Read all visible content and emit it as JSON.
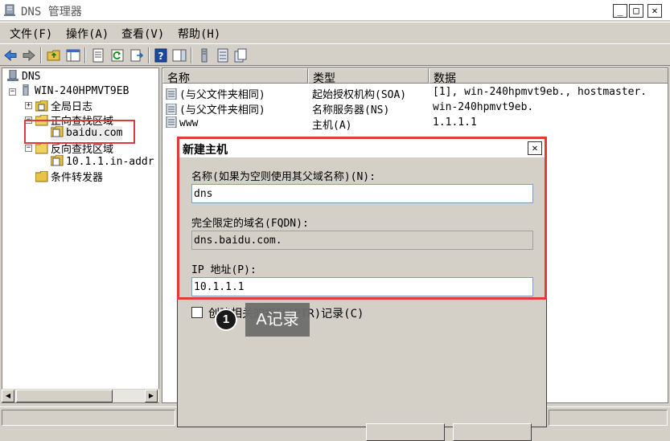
{
  "window": {
    "title": "DNS 管理器",
    "minimize": "_",
    "maximize": "□",
    "close": "✕"
  },
  "menu": [
    "文件(F)",
    "操作(A)",
    "查看(V)",
    "帮助(H)"
  ],
  "tree": {
    "root": "DNS",
    "server": "WIN-240HPMVT9EB",
    "global_logs": "全局日志",
    "forward_zones": "正向查找区域",
    "zone": "baidu.com",
    "reverse_zones": "反向查找区域",
    "reverse_zone": "10.1.1.in-addr",
    "forwarders": "条件转发器"
  },
  "list": {
    "columns": [
      "名称",
      "类型",
      "数据"
    ],
    "rows": [
      {
        "name": "(与父文件夹相同)",
        "type": "起始授权机构(SOA)",
        "data": "[1], win-240hpmvt9eb., hostmaster."
      },
      {
        "name": "(与父文件夹相同)",
        "type": "名称服务器(NS)",
        "data": "win-240hpmvt9eb."
      },
      {
        "name": "www",
        "type": "主机(A)",
        "data": "1.1.1.1"
      }
    ]
  },
  "dialog": {
    "title": "新建主机",
    "close": "✕",
    "name_label": "名称(如果为空则使用其父域名称)(N):",
    "name_value": "dns",
    "fqdn_label": "完全限定的域名(FQDN):",
    "fqdn_value": "dns.baidu.com.",
    "ip_label": "IP 地址(P):",
    "ip_value": "10.1.1.1",
    "ptr_label": "创建相关的指针(PTR)记录(C)"
  },
  "annotation": {
    "number": "1",
    "label": "A记录",
    "color": "#e03a3a"
  }
}
